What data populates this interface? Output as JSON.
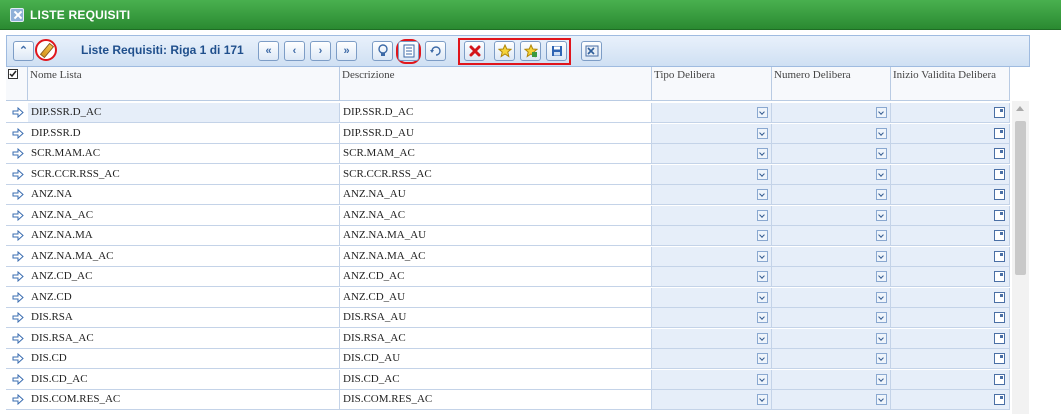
{
  "window": {
    "title": "LISTE REQUISITI"
  },
  "toolbar": {
    "nav_title": "Liste Requisiti: Riga 1 di 171",
    "first_label": "«",
    "prev_label": "‹",
    "next_label": "›",
    "last_label": "»"
  },
  "columns": [
    "Nome Lista",
    "Descrizione",
    "Tipo Delibera",
    "Numero Delibera",
    "Inizio Validita Delibera"
  ],
  "rows": [
    {
      "nome": "DIP.SSR.D_AC",
      "descrizione": "DIP.SSR.D_AC"
    },
    {
      "nome": "DIP.SSR.D",
      "descrizione": "DIP.SSR.D_AU"
    },
    {
      "nome": "SCR.MAM.AC",
      "descrizione": "SCR.MAM_AC"
    },
    {
      "nome": "SCR.CCR.RSS_AC",
      "descrizione": "SCR.CCR.RSS_AC"
    },
    {
      "nome": "ANZ.NA",
      "descrizione": "ANZ.NA_AU"
    },
    {
      "nome": "ANZ.NA_AC",
      "descrizione": "ANZ.NA_AC"
    },
    {
      "nome": "ANZ.NA.MA",
      "descrizione": "ANZ.NA.MA_AU"
    },
    {
      "nome": "ANZ.NA.MA_AC",
      "descrizione": "ANZ.NA.MA_AC"
    },
    {
      "nome": "ANZ.CD_AC",
      "descrizione": "ANZ.CD_AC"
    },
    {
      "nome": "ANZ.CD",
      "descrizione": "ANZ.CD_AU"
    },
    {
      "nome": "DIS.RSA",
      "descrizione": "DIS.RSA_AU"
    },
    {
      "nome": "DIS.RSA_AC",
      "descrizione": "DIS.RSA_AC"
    },
    {
      "nome": "DIS.CD",
      "descrizione": "DIS.CD_AU"
    },
    {
      "nome": "DIS.CD_AC",
      "descrizione": "DIS.CD_AC"
    },
    {
      "nome": "DIS.COM.RES_AC",
      "descrizione": "DIS.COM.RES_AC"
    }
  ],
  "colors": {
    "title_bar": "#2e8b34",
    "highlight": "#e0151c",
    "toolbar": "#d6e4f5",
    "link_text": "#1f4f8c"
  },
  "icons": [
    "close-window-icon",
    "collapse-icon",
    "edit-pencil-icon",
    "first-page-icon",
    "prev-page-icon",
    "next-page-icon",
    "last-page-icon",
    "bulb-icon",
    "list-detail-icon",
    "refresh-icon",
    "delete-icon",
    "star-icon",
    "star-add-icon",
    "save-icon",
    "excel-export-icon",
    "select-all-checkbox-icon",
    "row-arrow-icon",
    "dropdown-icon",
    "calendar-icon"
  ]
}
